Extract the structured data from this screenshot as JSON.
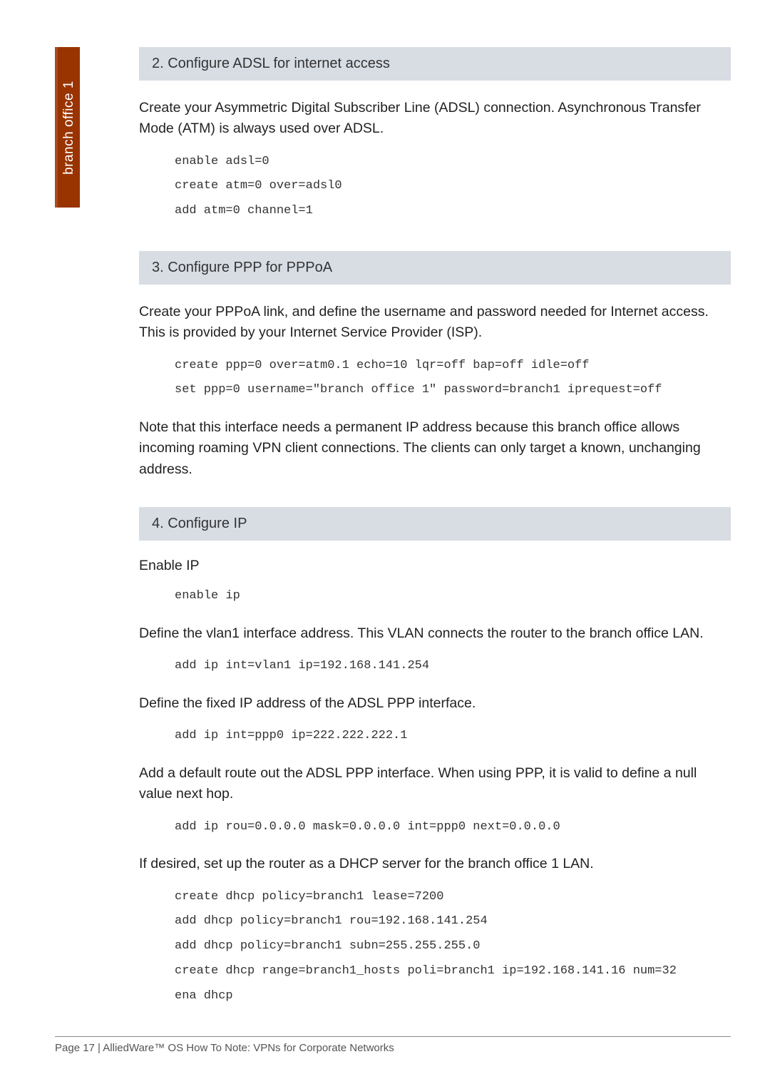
{
  "sidebar": {
    "label": "branch office 1"
  },
  "section2": {
    "title": "2.   Configure ADSL for internet access",
    "intro": "Create your Asymmetric Digital Subscriber Line (ADSL) connection. Asynchronous Transfer Mode (ATM) is always used over ADSL.",
    "code": "enable adsl=0\ncreate atm=0 over=adsl0\nadd atm=0 channel=1"
  },
  "section3": {
    "title": "3.   Configure PPP for PPPoA",
    "intro": "Create your PPPoA link, and define the username and password needed for Internet access. This is provided by your Internet Service Provider (ISP).",
    "code": "create ppp=0 over=atm0.1 echo=10 lqr=off bap=off idle=off\nset ppp=0 username=\"branch office 1\" password=branch1 iprequest=off",
    "note": "Note that this interface needs a permanent IP address because this branch office allows incoming roaming VPN client connections. The clients can only target a known, unchanging address."
  },
  "section4": {
    "title": "4.   Configure IP",
    "enable_label": "Enable IP",
    "enable_code": "enable ip",
    "vlan_text": "Define the vlan1 interface address. This VLAN connects the router to the branch office LAN.",
    "vlan_code": "add ip int=vlan1 ip=192.168.141.254",
    "fixed_text": "Define the fixed IP address of the ADSL PPP interface.",
    "fixed_code": "add ip int=ppp0 ip=222.222.222.1",
    "route_text": "Add a default route out the ADSL PPP interface. When using PPP, it is valid to define a null value next hop.",
    "route_code": "add ip rou=0.0.0.0 mask=0.0.0.0 int=ppp0 next=0.0.0.0",
    "dhcp_text": "If desired, set up the router as a DHCP server for the branch office 1 LAN.",
    "dhcp_code": "create dhcp policy=branch1 lease=7200\nadd dhcp policy=branch1 rou=192.168.141.254\nadd dhcp policy=branch1 subn=255.255.255.0\ncreate dhcp range=branch1_hosts poli=branch1 ip=192.168.141.16 num=32\nena dhcp"
  },
  "footer": {
    "text": "Page 17 | AlliedWare™ OS How To Note: VPNs for Corporate Networks"
  }
}
